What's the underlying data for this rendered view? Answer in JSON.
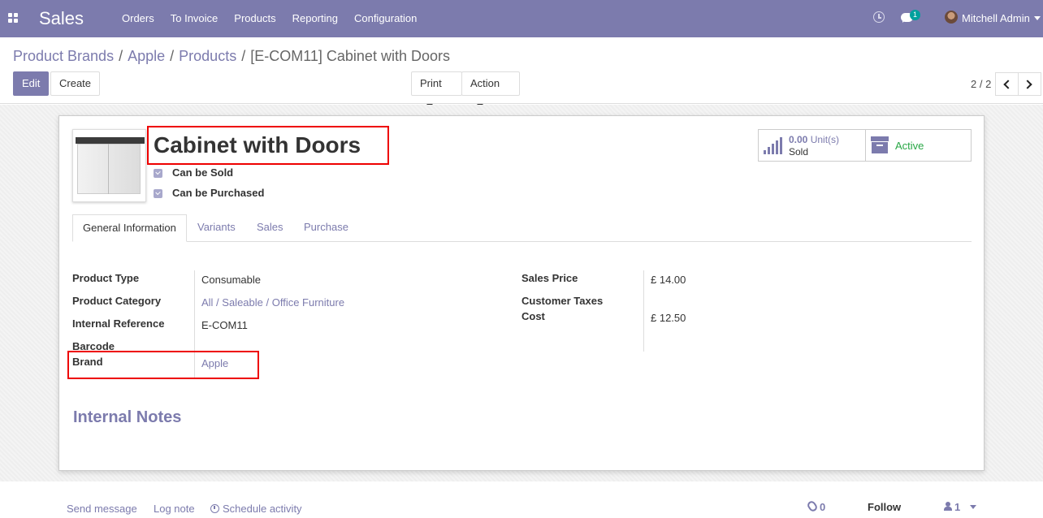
{
  "nav": {
    "app_title": "Sales",
    "menu": [
      "Orders",
      "To Invoice",
      "Products",
      "Reporting",
      "Configuration"
    ],
    "chat_badge": "1",
    "user_name": "Mitchell Admin"
  },
  "breadcrumb": {
    "items": [
      "Product Brands",
      "Apple",
      "Products"
    ],
    "current": "[E-COM11] Cabinet with Doors"
  },
  "toolbar": {
    "edit_label": "Edit",
    "create_label": "Create",
    "print_label": "Print",
    "action_label": "Action",
    "pager": "2 / 2"
  },
  "product": {
    "name": "Cabinet with Doors",
    "can_be_sold": "Can be Sold",
    "can_be_purchased": "Can be Purchased"
  },
  "stat": {
    "value": "0.00",
    "unit": "Unit(s)",
    "sub": "Sold",
    "active": "Active"
  },
  "tabs": [
    "General Information",
    "Variants",
    "Sales",
    "Purchase"
  ],
  "fields_left": {
    "product_type": {
      "label": "Product Type",
      "value": "Consumable"
    },
    "product_category": {
      "label": "Product Category",
      "value": "All / Saleable / Office Furniture"
    },
    "internal_reference": {
      "label": "Internal Reference",
      "value": "E-COM11"
    },
    "barcode": {
      "label": "Barcode",
      "value": ""
    },
    "brand": {
      "label": "Brand",
      "value": "Apple"
    }
  },
  "fields_right": {
    "sales_price": {
      "label": "Sales Price",
      "value": "£ 14.00"
    },
    "customer_taxes": {
      "label": "Customer Taxes",
      "value": ""
    },
    "cost": {
      "label": "Cost",
      "value": "£ 12.50"
    }
  },
  "notes_title": "Internal Notes",
  "chatter": {
    "send_message": "Send message",
    "log_note": "Log note",
    "schedule_activity": "Schedule activity",
    "attachments": "0",
    "follow": "Follow",
    "followers": "1"
  },
  "colors": {
    "brand": "#7c7bad",
    "highlight": "#ee0000",
    "active": "#28a745"
  }
}
